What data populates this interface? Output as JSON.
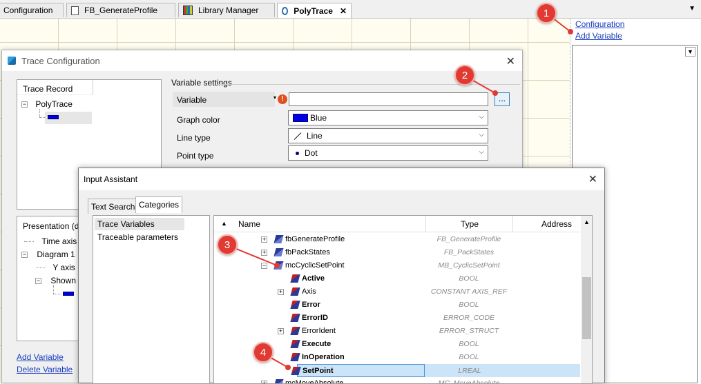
{
  "tabs": [
    {
      "label": "Configuration",
      "icon": "none"
    },
    {
      "label": "FB_GenerateProfile",
      "icon": "document-icon"
    },
    {
      "label": "Library Manager",
      "icon": "library-icon"
    },
    {
      "label": "PolyTrace",
      "icon": "polytrace-icon",
      "active": true
    }
  ],
  "tab_close": "✕",
  "tab_dropdown": "▼",
  "right_panel": {
    "configuration_link": "Configuration",
    "add_variable_link": "Add Variable"
  },
  "trace_config": {
    "title": "Trace Configuration",
    "trace_record_label": "Trace Record",
    "poly_trace_node": "PolyTrace",
    "presentation_label": "Presentation (d",
    "time_axis": "Time axis",
    "diagram_1": "Diagram 1",
    "y_axis": "Y axis",
    "shown": "Shown",
    "add_variable": "Add Variable",
    "delete_variable": "Delete Variable",
    "variable_settings": "Variable settings",
    "variable_label": "Variable",
    "variable_value": "",
    "browse_button": "...",
    "graph_color_label": "Graph color",
    "graph_color_value": "Blue",
    "line_type_label": "Line type",
    "line_type_value": "Line",
    "point_type_label": "Point type",
    "point_type_value": "Dot",
    "accent_color": "#0000e0"
  },
  "input_assistant": {
    "title": "Input Assistant",
    "tabs": [
      "Text Search",
      "Categories"
    ],
    "categories": [
      "Trace Variables",
      "Traceable parameters"
    ],
    "columns": {
      "name": "Name",
      "type": "Type",
      "address": "Address"
    },
    "rows": [
      {
        "name": "fbGenerateProfile",
        "type": "FB_GenerateProfile",
        "expander": "+",
        "bold": false
      },
      {
        "name": "fbPackStates",
        "type": "FB_PackStates",
        "expander": "+",
        "bold": false
      },
      {
        "name": "mcCyclicSetPoint",
        "type": "MB_CyclicSetPoint",
        "expander": "−",
        "bold": false
      },
      {
        "name": "Active",
        "type": "BOOL",
        "expander": "",
        "bold": true
      },
      {
        "name": "Axis",
        "type": "CONSTANT AXIS_REF",
        "expander": "+",
        "bold": false
      },
      {
        "name": "Error",
        "type": "BOOL",
        "expander": "",
        "bold": true
      },
      {
        "name": "ErrorID",
        "type": "ERROR_CODE",
        "expander": "",
        "bold": true
      },
      {
        "name": "ErrorIdent",
        "type": "ERROR_STRUCT",
        "expander": "+",
        "bold": false
      },
      {
        "name": "Execute",
        "type": "BOOL",
        "expander": "",
        "bold": true
      },
      {
        "name": "InOperation",
        "type": "BOOL",
        "expander": "",
        "bold": true
      },
      {
        "name": "SetPoint",
        "type": "LREAL",
        "expander": "",
        "bold": true,
        "selected": true
      },
      {
        "name": "mcMoveAbsolute",
        "type": "MC_MoveAbsolute",
        "expander": "+",
        "bold": false
      }
    ]
  },
  "callouts": [
    "1",
    "2",
    "3",
    "4"
  ],
  "callout_color": "#e03a32"
}
